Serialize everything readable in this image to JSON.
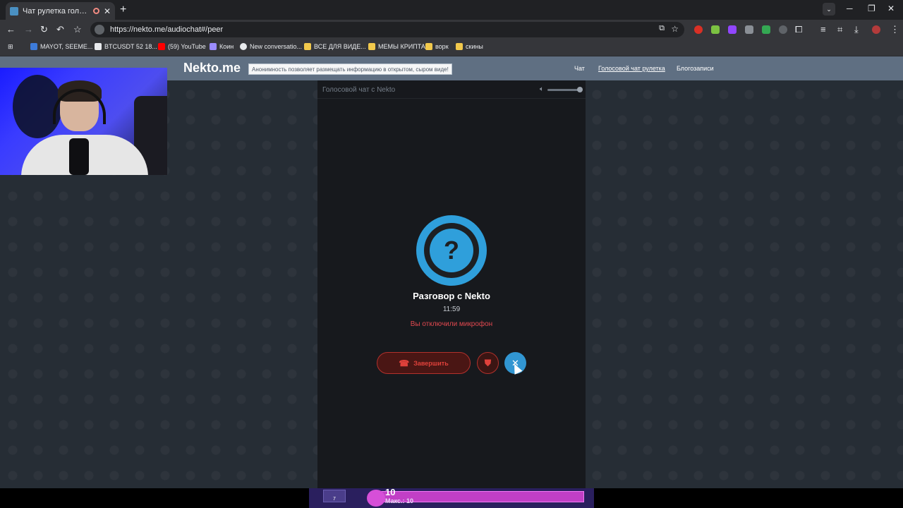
{
  "browser": {
    "tab_title": "Чат рулетка голосовая —",
    "tab_close": "✕",
    "new_tab": "+",
    "tab_search": "⌄",
    "window_minimize": "─",
    "window_restore": "❐",
    "window_close": "✕",
    "url": "https://nekto.me/audiochat#/peer"
  },
  "bookmarks": [
    {
      "label": "MAYOT, SEEME...",
      "icon": "bookmark-icon",
      "color": "#3d7bd9"
    },
    {
      "label": "BTCUSDT 52 18...",
      "icon": "tradingview-icon",
      "color": "#e8eaed"
    },
    {
      "label": "(59) YouTube",
      "icon": "youtube-icon",
      "color": "#ff0000"
    },
    {
      "label": "Коин",
      "icon": "coin-icon",
      "color": "#9b8cff"
    },
    {
      "label": "New conversatio...",
      "icon": "chatgpt-icon",
      "color": "#e8eaed"
    },
    {
      "label": "ВСЕ ДЛЯ ВИДЕ...",
      "icon": "folder-icon",
      "color": "#f2c94c"
    },
    {
      "label": "МЕМЫ КРИПТА",
      "icon": "folder-icon",
      "color": "#f2c94c"
    },
    {
      "label": "ворк",
      "icon": "folder-icon",
      "color": "#f2c94c"
    },
    {
      "label": "скины",
      "icon": "folder-icon",
      "color": "#f2c94c"
    }
  ],
  "site": {
    "logo": "Nekto.me",
    "notice": "Анонимность позволяет размещать информацию в открытом, сыром виде!",
    "nav": [
      {
        "label": "Чат",
        "active": false
      },
      {
        "label": "Голосовой чат рулетка",
        "active": true
      },
      {
        "label": "Блогозаписи",
        "active": false
      }
    ]
  },
  "chat": {
    "panel_title": "Голосовой чат с Nekto",
    "volume_level": 0.9,
    "avatar_symbol": "?",
    "conversation_title": "Разговор с Nekto",
    "timer": "11:59",
    "mic_status": "Вы отключили микрофон",
    "end_button": "Завершить",
    "accent_color": "#2f9fdb",
    "danger_color": "#e0413b"
  },
  "game_overlay": {
    "thumb_number": "7",
    "level": "10",
    "max_label": "Макс.: 10"
  }
}
